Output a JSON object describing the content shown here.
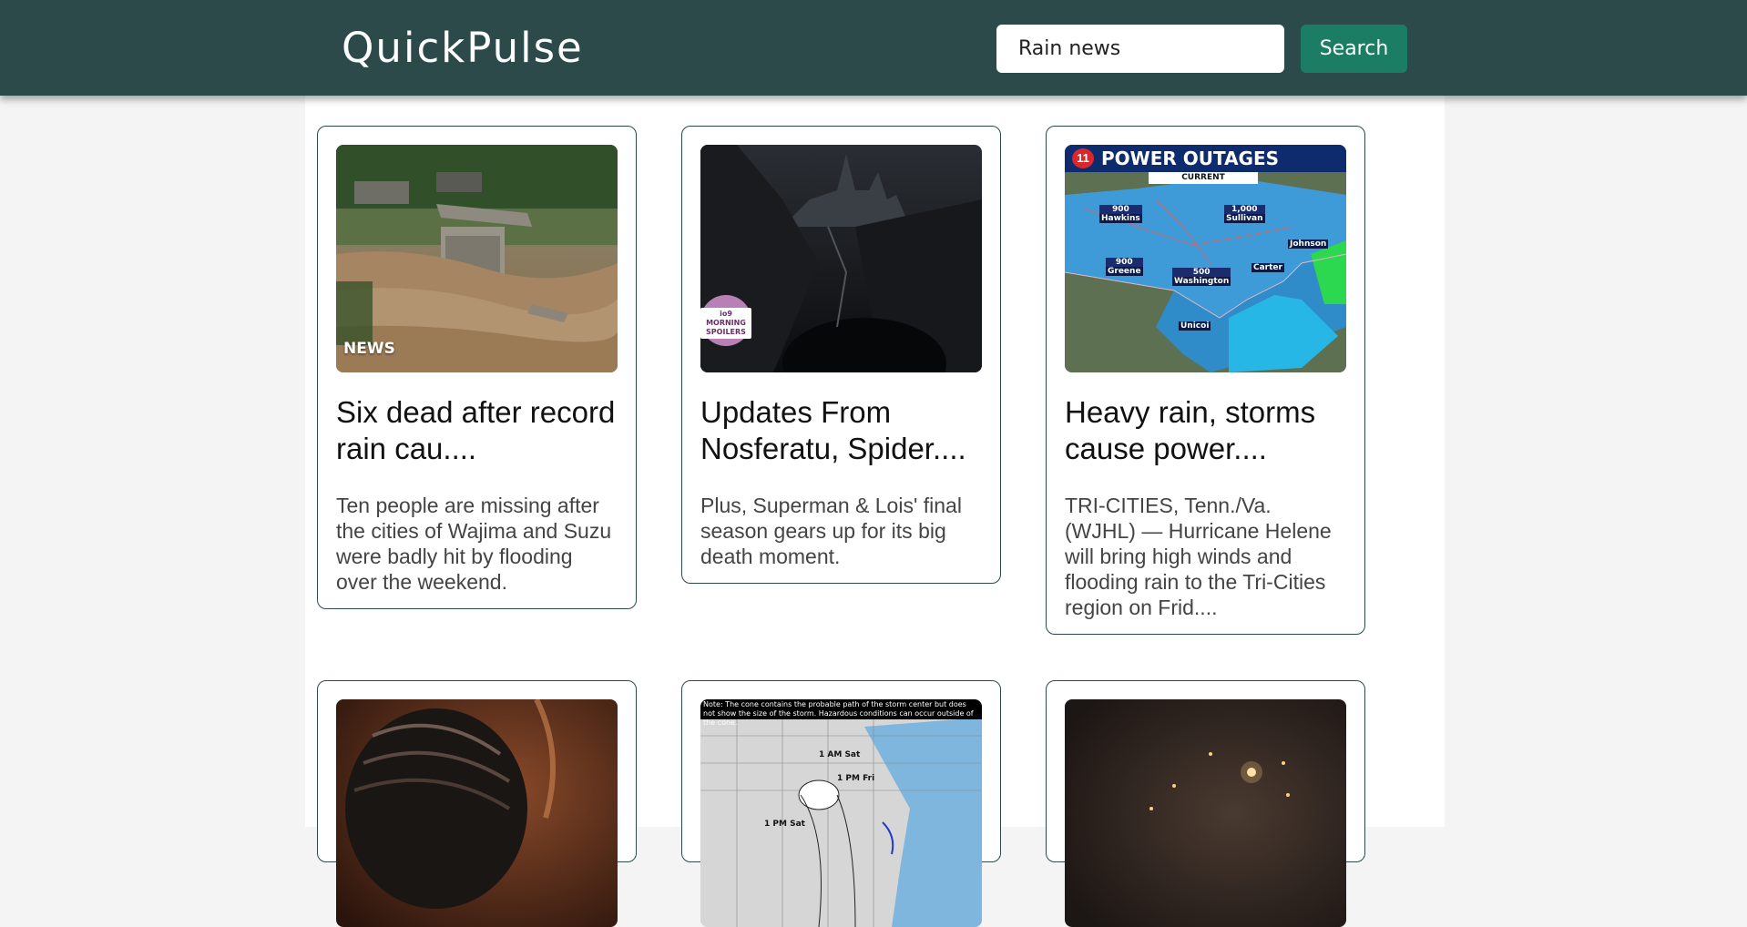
{
  "header": {
    "logo": "QuickPulse",
    "search_value": "Rain news",
    "search_button": "Search"
  },
  "cards": [
    {
      "title": "Six dead after record rain cau....",
      "description": "Ten people are missing after the cities of Wajima and Suzu were badly hit by flooding over the weekend.",
      "image_badge": "NEWS"
    },
    {
      "title": "Updates From Nosferatu, Spider....",
      "description": "Plus, Superman & Lois' final season gears up for its big death moment.",
      "image_badge": "io9 MORNING SPOILERS"
    },
    {
      "title": "Heavy rain, storms cause power....",
      "description": "TRI-CITIES, Tenn./Va. (WJHL) — Hurricane Helene will bring high winds and flooding rain to the Tri-Cities region on Frid....",
      "image": {
        "header": "POWER OUTAGES",
        "sub": "CURRENT",
        "channel": "11",
        "labels": [
          {
            "num": "900",
            "place": "Hawkins"
          },
          {
            "num": "1,000",
            "place": "Sullivan"
          },
          {
            "num": "900",
            "place": "Greene"
          },
          {
            "num": "500",
            "place": "Washington"
          }
        ],
        "places": [
          "Johnson",
          "Carter",
          "Unicoi"
        ]
      }
    },
    {
      "title": "",
      "description": ""
    },
    {
      "title": "",
      "description": "",
      "image": {
        "note": "Note: The cone contains the probable path of the storm center but does not show the size of the storm. Hazardous conditions can occur outside of the cone.",
        "times": [
          "1 AM Sat",
          "1 PM Fri",
          "1 PM Sat"
        ]
      }
    },
    {
      "title": "",
      "description": ""
    }
  ],
  "colors": {
    "navbar": "#2c4a4a",
    "search_button": "#1a7d64",
    "card_border": "#2c4a4a"
  }
}
